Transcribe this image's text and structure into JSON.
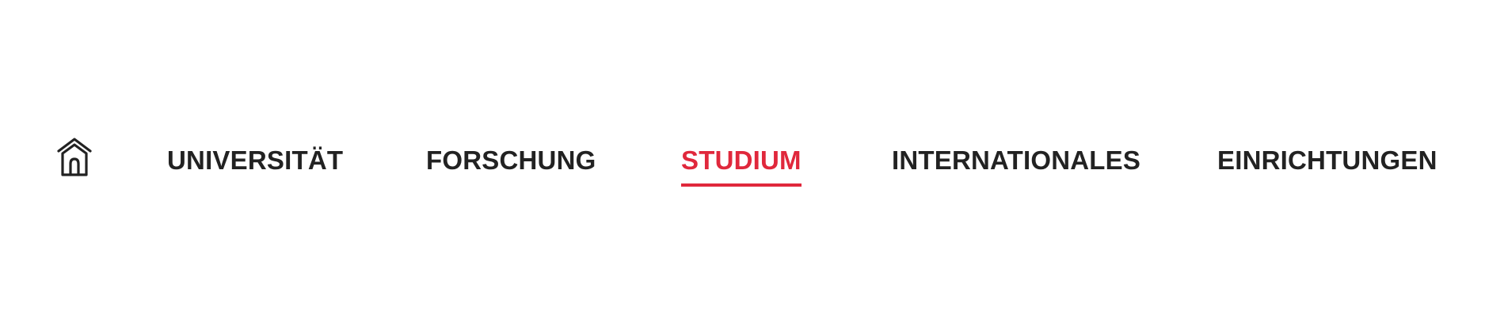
{
  "nav": {
    "home": {
      "icon": "home-icon"
    },
    "items": [
      {
        "label": "UNIVERSITÄT",
        "active": false
      },
      {
        "label": "FORSCHUNG",
        "active": false
      },
      {
        "label": "STUDIUM",
        "active": true
      },
      {
        "label": "INTERNATIONALES",
        "active": false
      },
      {
        "label": "EINRICHTUNGEN",
        "active": false
      }
    ]
  },
  "colors": {
    "text": "#222222",
    "accent": "#e0283c",
    "background": "#ffffff"
  }
}
